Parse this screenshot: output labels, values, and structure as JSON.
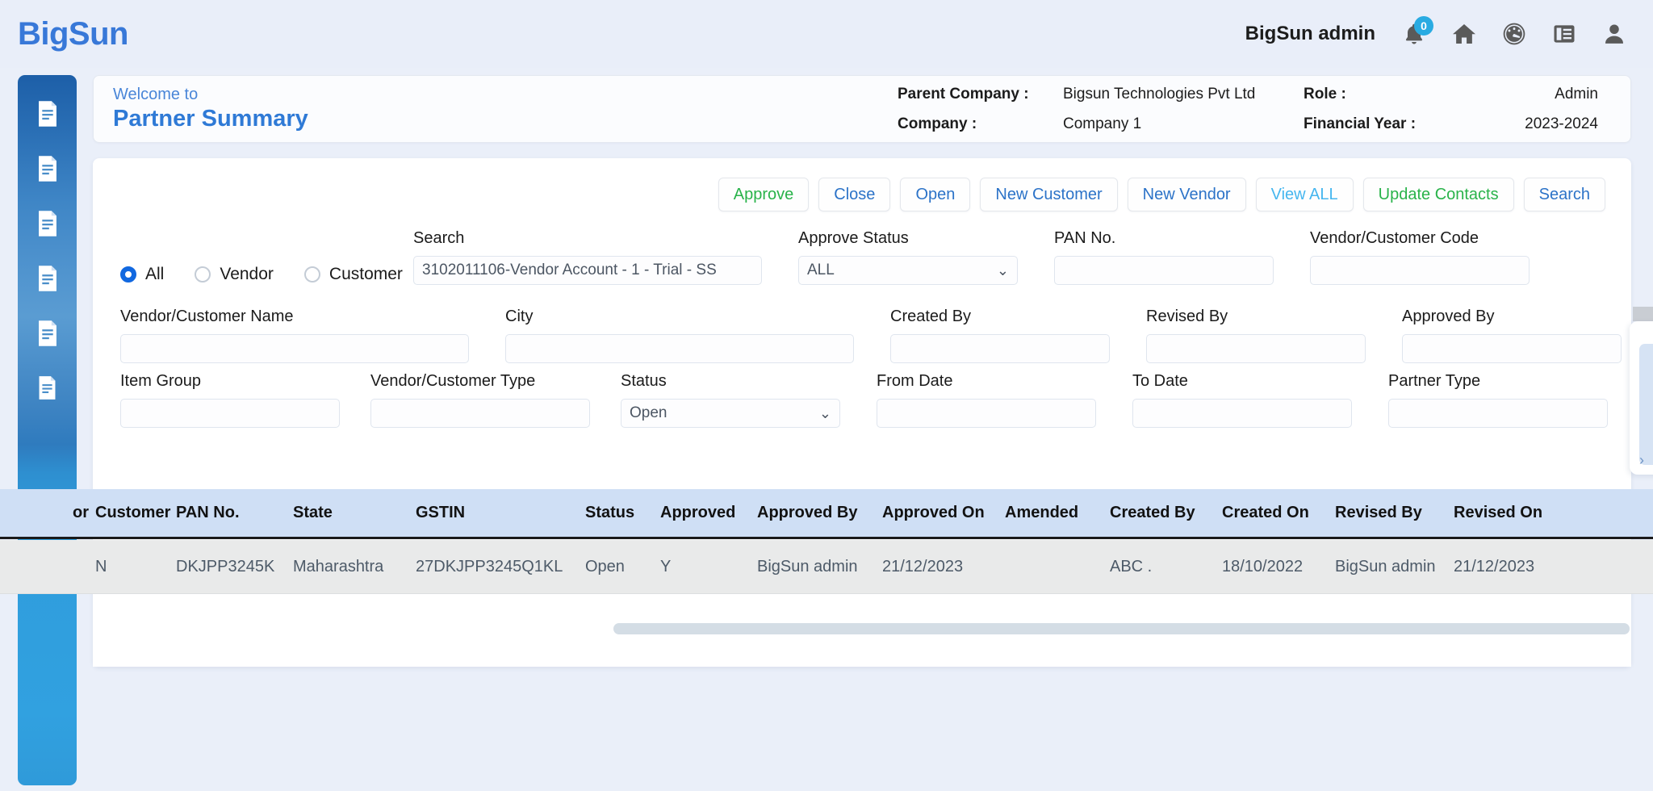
{
  "topbar": {
    "brand": "BigSun",
    "user": "BigSun admin",
    "notification_badge": "0",
    "icons": [
      "bell-icon",
      "home-icon",
      "dashboard-icon",
      "list-icon",
      "user-icon"
    ]
  },
  "sidebar": {
    "items": [
      {
        "icon": "document-icon"
      },
      {
        "icon": "document-icon"
      },
      {
        "icon": "document-icon"
      },
      {
        "icon": "document-icon"
      },
      {
        "icon": "document-icon"
      },
      {
        "icon": "document-icon"
      }
    ]
  },
  "welcome": {
    "greeting": "Welcome to",
    "title": "Partner Summary",
    "parent_company_label": "Parent Company :",
    "parent_company_value": "Bigsun Technologies Pvt Ltd",
    "company_label": "Company :",
    "company_value": "Company 1",
    "role_label": "Role :",
    "role_value": "Admin",
    "financial_year_label": "Financial Year :",
    "financial_year_value": "2023-2024"
  },
  "toolbar": {
    "approve": "Approve",
    "close": "Close",
    "open": "Open",
    "new_customer": "New Customer",
    "new_vendor": "New Vendor",
    "view_all": "View ALL",
    "update_contacts": "Update Contacts",
    "search": "Search"
  },
  "colors": {
    "brand_blue": "#3878d8",
    "accent_green": "#29b34a",
    "accent_blue": "#2c73c8",
    "accent_cyan": "#45b6ef",
    "badge_blue": "#29abe2",
    "table_header_bg": "#cfdff5",
    "table_row_bg": "#e9eaea"
  },
  "filters": {
    "radios": [
      {
        "label": "All",
        "checked": true
      },
      {
        "label": "Vendor",
        "checked": false
      },
      {
        "label": "Customer",
        "checked": false
      }
    ],
    "search": {
      "label": "Search",
      "value": "3102011106-Vendor Account - 1 - Trial - SS",
      "placeholder": ""
    },
    "approve_status": {
      "label": "Approve Status",
      "value": "ALL"
    },
    "pan_no": {
      "label": "PAN No.",
      "value": "",
      "placeholder": ""
    },
    "vendor_customer_code": {
      "label": "Vendor/Customer Code",
      "value": "",
      "placeholder": ""
    },
    "vendor_customer_name": {
      "label": "Vendor/Customer Name",
      "value": "",
      "placeholder": ""
    },
    "city": {
      "label": "City",
      "value": "",
      "placeholder": ""
    },
    "created_by": {
      "label": "Created By",
      "value": "",
      "placeholder": ""
    },
    "revised_by": {
      "label": "Revised By",
      "value": "",
      "placeholder": ""
    },
    "approved_by": {
      "label": "Approved By",
      "value": "",
      "placeholder": ""
    },
    "item_group": {
      "label": "Item Group",
      "value": "",
      "placeholder": ""
    },
    "vendor_customer_type": {
      "label": "Vendor/Customer Type",
      "value": "",
      "placeholder": ""
    },
    "status": {
      "label": "Status",
      "value": "Open"
    },
    "from_date": {
      "label": "From Date",
      "value": "",
      "placeholder": ""
    },
    "to_date": {
      "label": "To Date",
      "value": "",
      "placeholder": ""
    },
    "partner_type": {
      "label": "Partner Type",
      "value": "",
      "placeholder": ""
    }
  },
  "table": {
    "columns": [
      "or",
      "Customer",
      "PAN No.",
      "State",
      "GSTIN",
      "Status",
      "Approved",
      "Approved By",
      "Approved On",
      "Amended",
      "Created By",
      "Created On",
      "Revised By",
      "Revised On"
    ],
    "rows": [
      {
        "vendor": "",
        "customer": "N",
        "pan_no": "DKJPP3245K",
        "state": "Maharashtra",
        "gstin": "27DKJPP3245Q1KL",
        "status": "Open",
        "approved": "Y",
        "approved_by": "BigSun admin",
        "approved_on": "21/12/2023",
        "amended": "",
        "created_by": "ABC .",
        "created_on": "18/10/2022",
        "revised_by": "BigSun admin",
        "revised_on": "21/12/2023"
      }
    ]
  }
}
